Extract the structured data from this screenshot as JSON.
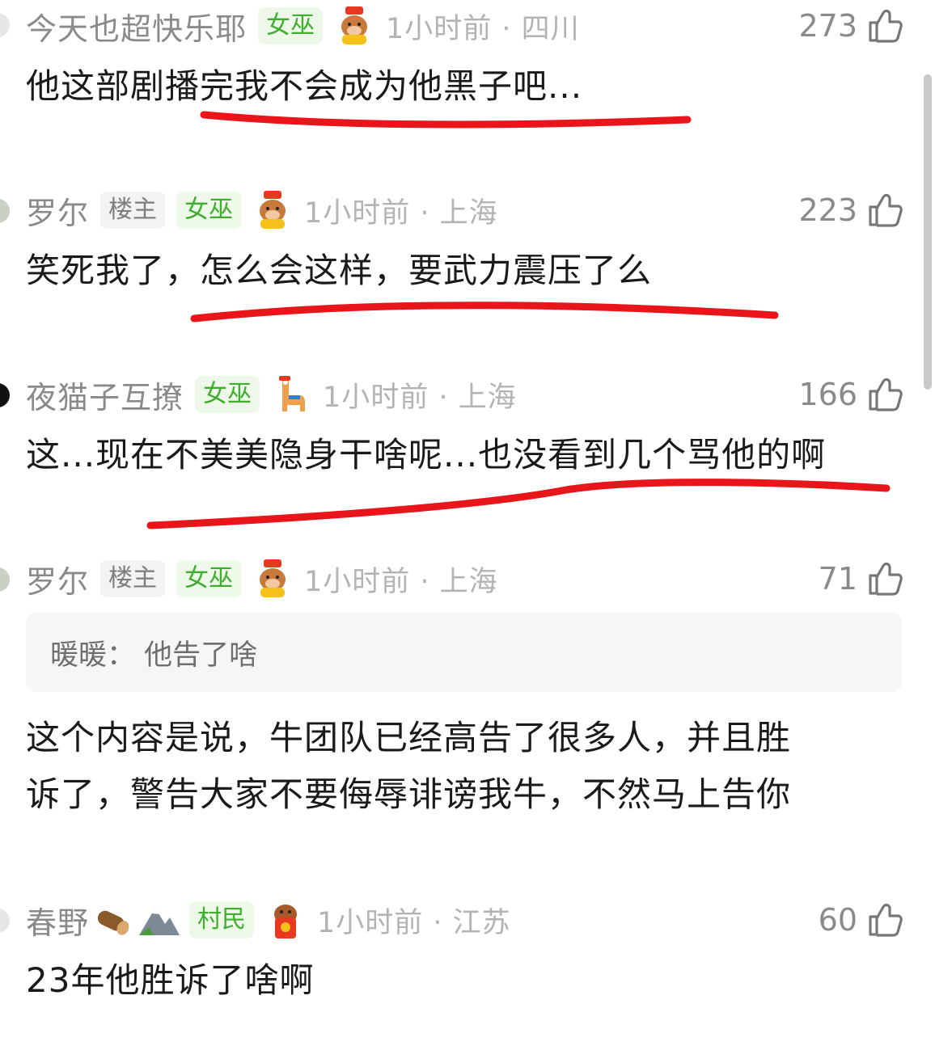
{
  "comments": [
    {
      "username": "今天也超快乐耶",
      "badges": [
        "女巫"
      ],
      "emblem": "cow-god-of-wealth-emblem",
      "time_location": "1小时前 · 四川",
      "likes": "273",
      "text": "他这部剧播完我不会成为他黑子吧..."
    },
    {
      "username": "罗尔",
      "owner_badge": "楼主",
      "badges": [
        "女巫"
      ],
      "emblem": "cow-god-of-wealth-emblem",
      "time_location": "1小时前 · 上海",
      "likes": "223",
      "text": "笑死我了，怎么会这样，要武力震压了么"
    },
    {
      "username": "夜猫子互撩",
      "badges": [
        "女巫"
      ],
      "emblem": "alpaca-emblem",
      "time_location": "1小时前 · 上海",
      "likes": "166",
      "text": "这...现在不美美隐身干啥呢...也没看到几个骂他的啊"
    },
    {
      "username": "罗尔",
      "owner_badge": "楼主",
      "badges": [
        "女巫"
      ],
      "emblem": "cow-god-of-wealth-emblem",
      "time_location": "1小时前 · 上海",
      "likes": "71",
      "quote": "暖暖：  他告了啥",
      "text_lines": [
        "这个内容是说，牛团队已经高告了很多人，并且胜",
        "诉了，警告大家不要侮辱诽谤我牛，不然马上告你"
      ]
    },
    {
      "username": "春野",
      "name_emojis": [
        "log-emoji",
        "mountain-emoji"
      ],
      "badges": [
        "村民"
      ],
      "emblem": "cow-red-envelope-emblem",
      "time_location": "1小时前 · 江苏",
      "likes": "60",
      "text": "23年他胜诉了啥啊"
    }
  ],
  "colors": {
    "underline_red": "#e8161b",
    "badge_green": "#3fae2e",
    "meta_gray": "#8a8a8a",
    "time_gray": "#b3b3b3"
  }
}
